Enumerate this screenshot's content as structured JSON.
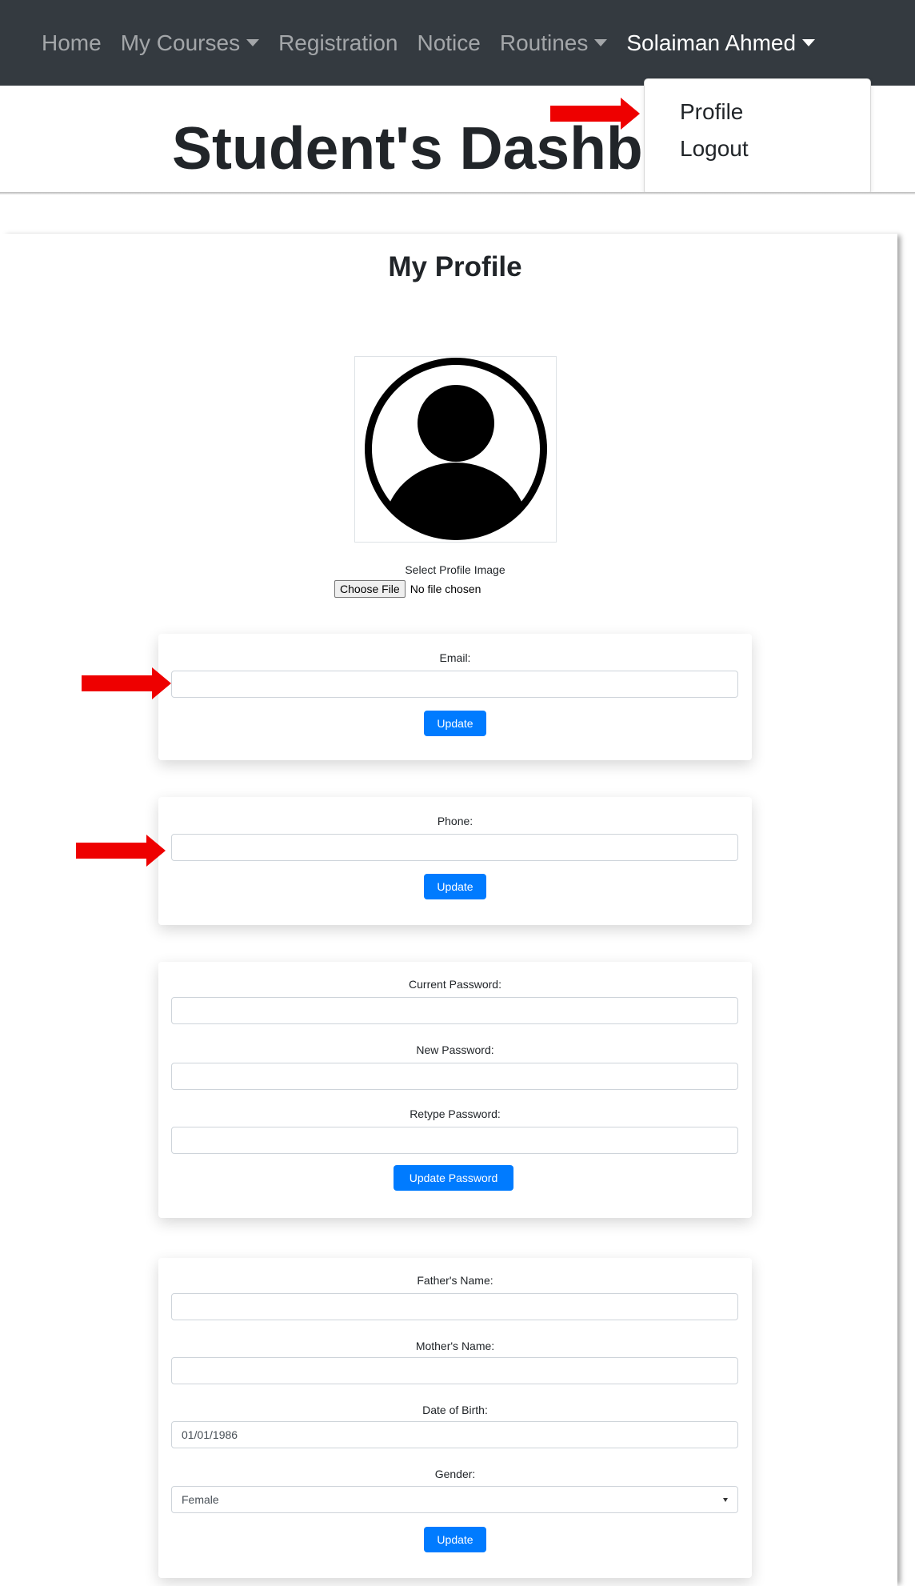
{
  "navbar": {
    "items": [
      "Home",
      "My Courses",
      "Registration",
      "Notice",
      "Routines"
    ],
    "user_name": "Solaiman Ahmed",
    "dropdown": [
      "Profile",
      "Logout"
    ]
  },
  "dashboard_heading": "Student's Dashboard",
  "profile": {
    "title": "My Profile",
    "select_image_label": "Select Profile Image",
    "choose_file_label": "Choose File",
    "file_status": "No file chosen"
  },
  "email_card": {
    "label": "Email:",
    "value": "",
    "button": "Update"
  },
  "phone_card": {
    "label": "Phone:",
    "value": "",
    "button": "Update"
  },
  "password_card": {
    "current_label": "Current Password:",
    "new_label": "New Password:",
    "retype_label": "Retype Password:",
    "button": "Update Password"
  },
  "details_card": {
    "father_label": "Father's Name:",
    "father_value": "",
    "mother_label": "Mother's Name:",
    "mother_value": "",
    "dob_label": "Date of Birth:",
    "dob_value": "01/01/1986",
    "gender_label": "Gender:",
    "gender_value": "Female",
    "button": "Update"
  },
  "colors": {
    "navbar_bg": "#343a40",
    "primary_button": "#007bff",
    "annotation_arrow": "#ee0000"
  },
  "icons": {
    "avatar": "user-avatar-icon",
    "annotation": "red-arrow-icon",
    "caret": "caret-down-icon"
  }
}
